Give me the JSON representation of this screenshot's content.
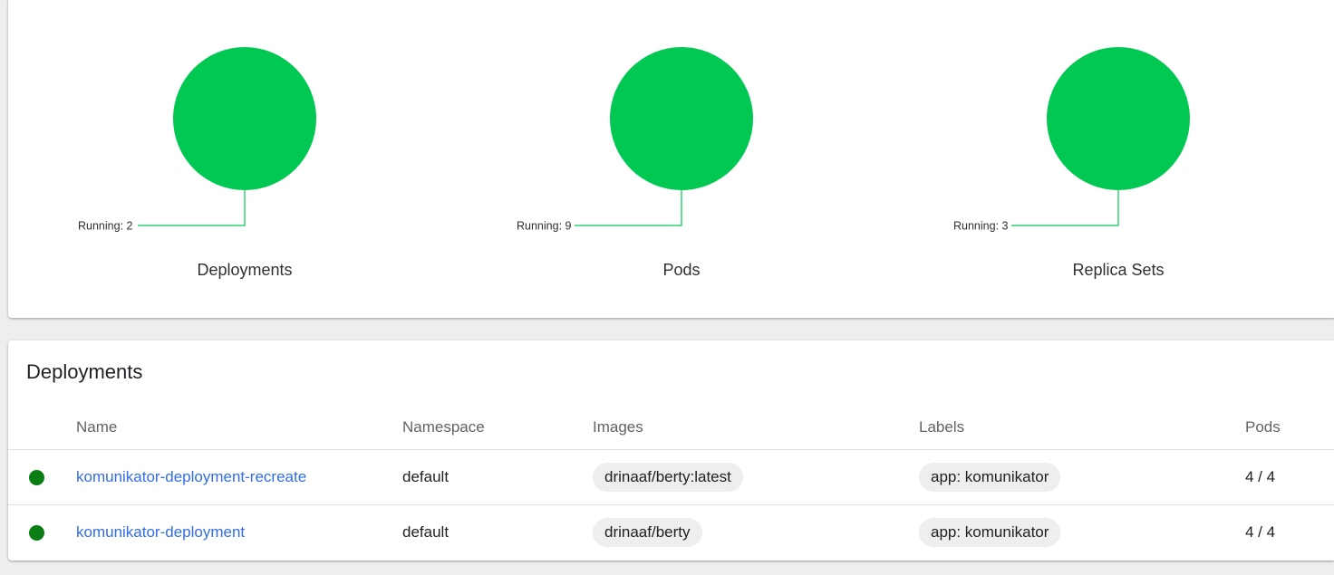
{
  "colors": {
    "running": "#00c853",
    "status_ok": "#0a7d14",
    "link": "#326de6"
  },
  "status_summary": [
    {
      "caption": "Deployments",
      "running_label": "Running: 2"
    },
    {
      "caption": "Pods",
      "running_label": "Running: 9"
    },
    {
      "caption": "Replica Sets",
      "running_label": "Running: 3"
    }
  ],
  "deployments": {
    "title": "Deployments",
    "columns": {
      "name": "Name",
      "namespace": "Namespace",
      "images": "Images",
      "labels": "Labels",
      "pods": "Pods"
    },
    "rows": [
      {
        "status_icon": "running-status-icon",
        "name": "komunikator-deployment-recreate",
        "namespace": "default",
        "image": "drinaaf/berty:latest",
        "label": "app: komunikator",
        "pods": "4 / 4"
      },
      {
        "status_icon": "running-status-icon",
        "name": "komunikator-deployment",
        "namespace": "default",
        "image": "drinaaf/berty",
        "label": "app: komunikator",
        "pods": "4 / 4"
      }
    ]
  }
}
